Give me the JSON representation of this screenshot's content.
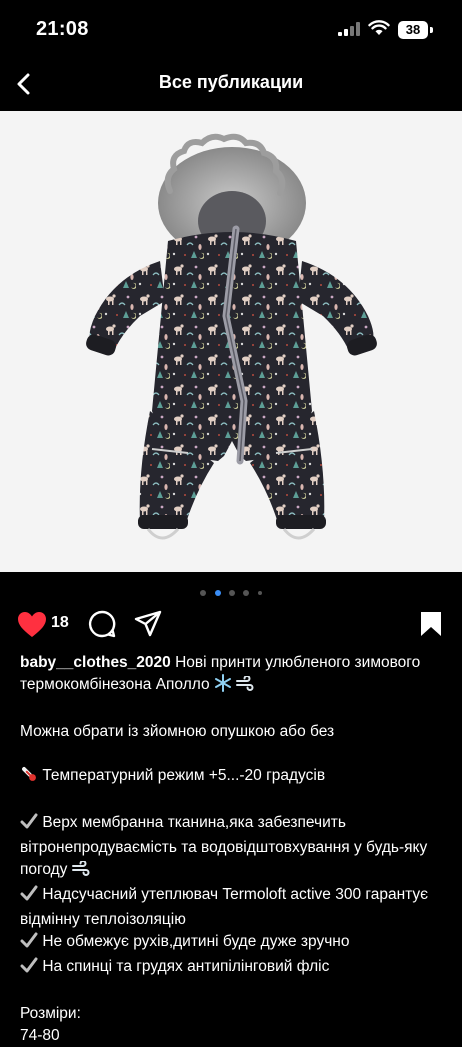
{
  "status_bar": {
    "time": "21:08",
    "battery": "38",
    "icons": [
      "signal-icon",
      "wifi-icon",
      "battery-icon"
    ]
  },
  "nav": {
    "back_icon": "chevron-left-icon",
    "title": "Все публикации"
  },
  "post": {
    "image_alt": "Дитячий зимовий комбінезон з хутряною опушкою",
    "carousel": {
      "count": 5,
      "active_index": 1
    },
    "likes": "18",
    "liked": true,
    "colors": {
      "like": "#ff3040",
      "active_dot": "#3a8ef6"
    },
    "action_icons": [
      "heart-icon",
      "comment-icon",
      "share-icon",
      "bookmark-icon"
    ],
    "caption": {
      "username": "baby__clothes_2020",
      "intro": "Нові принти улюбленого зимового термокомбінезона Аполло",
      "line_option": "Можна обрати із зйомною опушкою або без",
      "line_temp": "Температурний режим +5...-20 градусів",
      "bullet_1": "Верх мембранна тканина,яка забезпечить вітронепродуваємість  та водовідштовхування у будь-яку погоду",
      "bullet_2": "Надсучасний утеплювач Termoloft active 300 гарантує відмінну теплоізоляцію",
      "bullet_3": "Не обмежує рухів,дитині буде дуже зручно",
      "bullet_4": "На спинці та грудях антипілінговий фліс",
      "sizes_label": "Розміри:",
      "sizes_value": "74-80"
    }
  }
}
